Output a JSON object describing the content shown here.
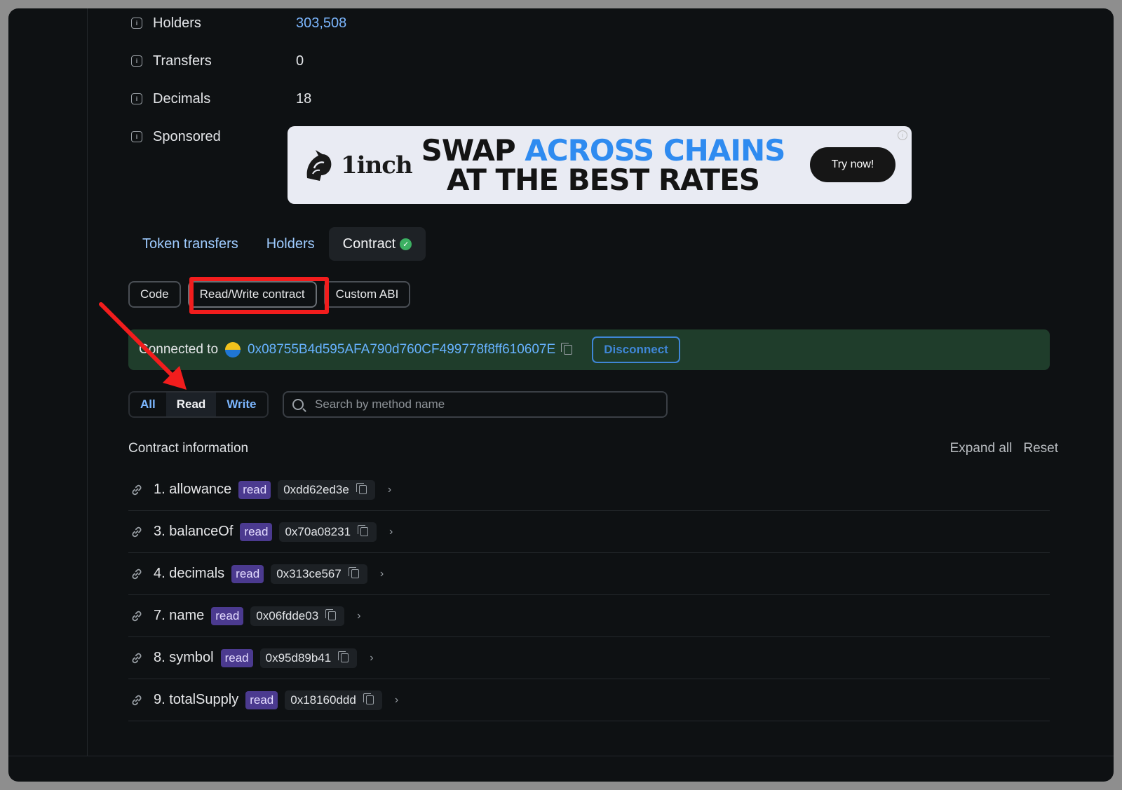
{
  "info": [
    {
      "label": "Holders",
      "value": "303,508",
      "is_link": true
    },
    {
      "label": "Transfers",
      "value": "0",
      "is_link": false
    },
    {
      "label": "Decimals",
      "value": "18",
      "is_link": false
    },
    {
      "label": "Sponsored",
      "value": "",
      "is_link": false
    }
  ],
  "banner": {
    "brand": "1inch",
    "line1_a": "SWAP ",
    "line1_b": "ACROSS CHAINS",
    "line2": "AT THE BEST RATES",
    "cta": "Try now!",
    "accent_color": "#2f8bf0"
  },
  "tabs": [
    {
      "label": "Token transfers"
    },
    {
      "label": "Holders"
    },
    {
      "label": "Contract"
    }
  ],
  "subtabs": [
    {
      "label": "Code"
    },
    {
      "label": "Read/Write contract"
    },
    {
      "label": "Custom ABI"
    }
  ],
  "connection": {
    "label": "Connected to",
    "address": "0x08755B4d595AFA790d760CF499778f8ff610607E",
    "disconnect": "Disconnect"
  },
  "filter": {
    "options": [
      "All",
      "Read",
      "Write"
    ],
    "selected": "Read"
  },
  "search": {
    "placeholder": "Search by method name"
  },
  "contract": {
    "title": "Contract information",
    "expand_all": "Expand all",
    "reset": "Reset",
    "methods": [
      {
        "name": "1. allowance",
        "type": "read",
        "sig": "0xdd62ed3e"
      },
      {
        "name": "3. balanceOf",
        "type": "read",
        "sig": "0x70a08231"
      },
      {
        "name": "4. decimals",
        "type": "read",
        "sig": "0x313ce567"
      },
      {
        "name": "7. name",
        "type": "read",
        "sig": "0x06fdde03"
      },
      {
        "name": "8. symbol",
        "type": "read",
        "sig": "0x95d89b41"
      },
      {
        "name": "9. totalSupply",
        "type": "read",
        "sig": "0x18160ddd"
      }
    ]
  },
  "colors": {
    "annotation_red": "#f21d1d",
    "connected_bg": "#1f3d2b",
    "link_blue": "#7cb7ff",
    "badge_purple": "#4b3a8f"
  }
}
